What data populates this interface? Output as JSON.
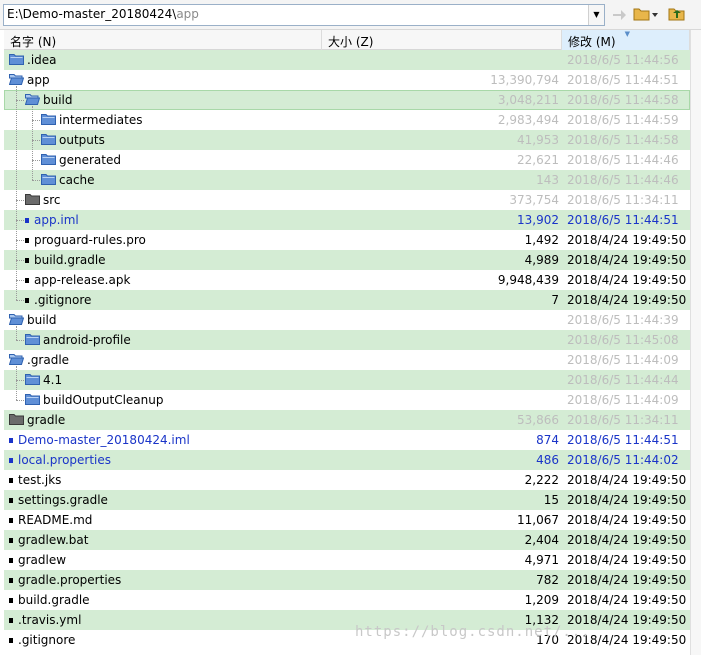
{
  "toolbar": {
    "path_prefix": "E:\\Demo-master_20180424\\",
    "path_tail": "app",
    "dropdown_glyph": "▼"
  },
  "columns": [
    {
      "label": "名字 (N)"
    },
    {
      "label": "大小 (Z)"
    },
    {
      "label": "修改 (M)"
    }
  ],
  "rows": [
    {
      "name": ".idea",
      "size": "",
      "date": "2018/6/5 11:44:56",
      "kind": "folder",
      "depth": 0,
      "style": "faded"
    },
    {
      "name": "app",
      "size": "13,390,794",
      "date": "2018/6/5 11:44:51",
      "kind": "folder-open",
      "depth": 0,
      "style": "faded"
    },
    {
      "name": "build",
      "size": "3,048,211",
      "date": "2018/6/5 11:44:58",
      "kind": "folder-open",
      "depth": 1,
      "style": "faded"
    },
    {
      "name": "intermediates",
      "size": "2,983,494",
      "date": "2018/6/5 11:44:59",
      "kind": "folder",
      "depth": 2,
      "style": "faded"
    },
    {
      "name": "outputs",
      "size": "41,953",
      "date": "2018/6/5 11:44:58",
      "kind": "folder",
      "depth": 2,
      "style": "faded"
    },
    {
      "name": "generated",
      "size": "22,621",
      "date": "2018/6/5 11:44:46",
      "kind": "folder",
      "depth": 2,
      "style": "faded"
    },
    {
      "name": "cache",
      "size": "143",
      "date": "2018/6/5 11:44:46",
      "kind": "folder",
      "depth": 2,
      "style": "faded"
    },
    {
      "name": "src",
      "size": "373,754",
      "date": "2018/6/5 11:34:11",
      "kind": "folder-dark",
      "depth": 1,
      "style": "faded"
    },
    {
      "name": "app.iml",
      "size": "13,902",
      "date": "2018/6/5 11:44:51",
      "kind": "file",
      "depth": 1,
      "style": "blue"
    },
    {
      "name": "proguard-rules.pro",
      "size": "1,492",
      "date": "2018/4/24 19:49:50",
      "kind": "file",
      "depth": 1,
      "style": "normal"
    },
    {
      "name": "build.gradle",
      "size": "4,989",
      "date": "2018/4/24 19:49:50",
      "kind": "file",
      "depth": 1,
      "style": "normal"
    },
    {
      "name": "app-release.apk",
      "size": "9,948,439",
      "date": "2018/4/24 19:49:50",
      "kind": "file",
      "depth": 1,
      "style": "normal"
    },
    {
      "name": ".gitignore",
      "size": "7",
      "date": "2018/4/24 19:49:50",
      "kind": "file",
      "depth": 1,
      "style": "normal"
    },
    {
      "name": "build",
      "size": "",
      "date": "2018/6/5 11:44:39",
      "kind": "folder-open",
      "depth": 0,
      "style": "faded"
    },
    {
      "name": "android-profile",
      "size": "",
      "date": "2018/6/5 11:45:08",
      "kind": "folder",
      "depth": 1,
      "style": "faded"
    },
    {
      "name": ".gradle",
      "size": "",
      "date": "2018/6/5 11:44:09",
      "kind": "folder-open",
      "depth": 0,
      "style": "faded"
    },
    {
      "name": "4.1",
      "size": "",
      "date": "2018/6/5 11:44:44",
      "kind": "folder",
      "depth": 1,
      "style": "faded"
    },
    {
      "name": "buildOutputCleanup",
      "size": "",
      "date": "2018/6/5 11:44:09",
      "kind": "folder",
      "depth": 1,
      "style": "faded"
    },
    {
      "name": "gradle",
      "size": "53,866",
      "date": "2018/6/5 11:34:11",
      "kind": "folder-dark",
      "depth": 0,
      "style": "faded"
    },
    {
      "name": "Demo-master_20180424.iml",
      "size": "874",
      "date": "2018/6/5 11:44:51",
      "kind": "file",
      "depth": 0,
      "style": "blue"
    },
    {
      "name": "local.properties",
      "size": "486",
      "date": "2018/6/5 11:44:02",
      "kind": "file",
      "depth": 0,
      "style": "blue"
    },
    {
      "name": "test.jks",
      "size": "2,222",
      "date": "2018/4/24 19:49:50",
      "kind": "file",
      "depth": 0,
      "style": "normal"
    },
    {
      "name": "settings.gradle",
      "size": "15",
      "date": "2018/4/24 19:49:50",
      "kind": "file",
      "depth": 0,
      "style": "normal"
    },
    {
      "name": "README.md",
      "size": "11,067",
      "date": "2018/4/24 19:49:50",
      "kind": "file",
      "depth": 0,
      "style": "normal"
    },
    {
      "name": "gradlew.bat",
      "size": "2,404",
      "date": "2018/4/24 19:49:50",
      "kind": "file",
      "depth": 0,
      "style": "normal"
    },
    {
      "name": "gradlew",
      "size": "4,971",
      "date": "2018/4/24 19:49:50",
      "kind": "file",
      "depth": 0,
      "style": "normal"
    },
    {
      "name": "gradle.properties",
      "size": "782",
      "date": "2018/4/24 19:49:50",
      "kind": "file",
      "depth": 0,
      "style": "normal"
    },
    {
      "name": "build.gradle",
      "size": "1,209",
      "date": "2018/4/24 19:49:50",
      "kind": "file",
      "depth": 0,
      "style": "normal"
    },
    {
      "name": ".travis.yml",
      "size": "1,132",
      "date": "2018/4/24 19:49:50",
      "kind": "file",
      "depth": 0,
      "style": "normal"
    },
    {
      "name": ".gitignore",
      "size": "170",
      "date": "2018/4/24 19:49:50",
      "kind": "file",
      "depth": 0,
      "style": "normal"
    }
  ],
  "watermark": "https://blog.csdn.net/...",
  "colors": {
    "row_alt": "#d4ecd4",
    "link_blue": "#1a34c8",
    "faded_text": "#bdbdbd",
    "folder_blue": "#5f8fd6",
    "folder_dark": "#6b6b6b"
  }
}
